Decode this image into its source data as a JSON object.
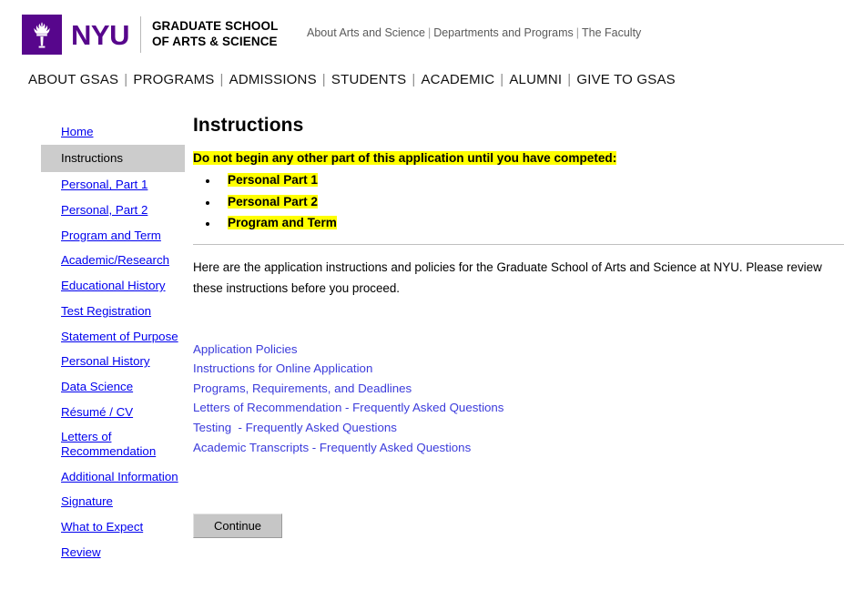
{
  "masthead": {
    "logo_icon": "nyu-torch-icon",
    "wordmark": "NYU",
    "school_name": "GRADUATE SCHOOL\nOF ARTS & SCIENCE",
    "brand_color": "#57068c",
    "top_links": [
      "About Arts and Science",
      "Departments and Programs",
      "The Faculty"
    ],
    "separator": "|"
  },
  "mainnav": {
    "items": [
      "ABOUT GSAS",
      "PROGRAMS",
      "ADMISSIONS",
      "STUDENTS",
      "ACADEMIC",
      "ALUMNI",
      "GIVE TO GSAS"
    ],
    "separator": "|"
  },
  "sidebar": {
    "items": [
      {
        "label": "Home",
        "current": false
      },
      {
        "label": "Instructions",
        "current": true
      },
      {
        "label": "Personal, Part 1",
        "current": false
      },
      {
        "label": "Personal, Part 2",
        "current": false
      },
      {
        "label": "Program and Term",
        "current": false
      },
      {
        "label": "Academic/Research",
        "current": false
      },
      {
        "label": "Educational History",
        "current": false
      },
      {
        "label": "Test Registration",
        "current": false
      },
      {
        "label": "Statement of Purpose",
        "current": false
      },
      {
        "label": "Personal History",
        "current": false
      },
      {
        "label": "Data Science",
        "current": false
      },
      {
        "label": "Résumé / CV",
        "current": false
      },
      {
        "label": "Letters of Recommendation",
        "current": false
      },
      {
        "label": "Additional Information",
        "current": false
      },
      {
        "label": "Signature",
        "current": false
      },
      {
        "label": "What to Expect",
        "current": false
      },
      {
        "label": "Review",
        "current": false
      }
    ],
    "link_color": "#0000ee",
    "current_bg": "#cccccc"
  },
  "content": {
    "title": "Instructions",
    "warning": "Do not begin any other part of this application until you have competed:",
    "highlight_color": "#ffff00",
    "checklist": [
      "Personal Part 1",
      "Personal Part 2",
      "Program and Term"
    ],
    "intro": "Here are the application instructions and policies for the Graduate School of Arts and Science at NYU. Please review these instructions before you proceed.",
    "doc_links": [
      "Application Policies",
      "Instructions for Online Application",
      "Programs, Requirements, and Deadlines",
      "Letters of Recommendation - Frequently Asked Questions",
      "Testing  - Frequently Asked Questions",
      "Academic Transcripts - Frequently Asked Questions"
    ],
    "doc_link_color": "#3b3bdb",
    "continue_label": "Continue"
  }
}
